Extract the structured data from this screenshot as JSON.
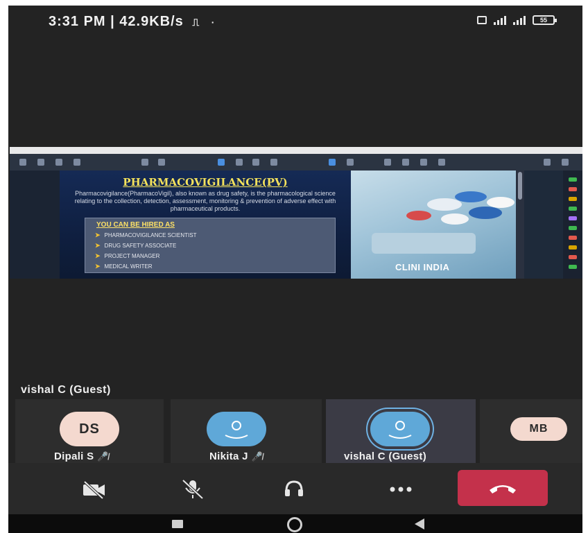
{
  "status_bar": {
    "time_speed": "3:31 PM | 42.9KB/s",
    "battery": "55"
  },
  "shared_screen": {
    "slide": {
      "title": "PHARMACOVIGILANCE(PV)",
      "description": "Pharmacovigilance(PharmacoVigil), also known as drug safety, is the pharmacological science relating to the collection, detection, assessment, monitoring & prevention of adverse effect with pharmaceutical products.",
      "box_heading": "YOU CAN BE HIRED AS",
      "bullets": [
        "PHARMACOVIGILANCE SCIENTIST",
        "DRUG SAFETY ASSOCIATE",
        "PROJECT MANAGER",
        "MEDICAL WRITER"
      ],
      "logo_text": "CLINI INDIA"
    }
  },
  "presenter_label": "vishal C (Guest)",
  "participants": [
    {
      "initials": "DS",
      "name": "Dipali S",
      "muted": "✕"
    },
    {
      "initials": "",
      "name": "Nikita J",
      "muted": "✕"
    },
    {
      "initials": "",
      "name": "vishal C (Guest)",
      "muted": ""
    },
    {
      "initials": "MB",
      "name": "",
      "muted": ""
    }
  ],
  "colors": {
    "end_call": "#c4314b",
    "avatar_blue": "#5fa8d8",
    "avatar_peach": "#f4d9cf",
    "slide_title": "#f4e25c",
    "background": "#232323"
  },
  "icons": {
    "camera": "camera-off-icon",
    "mic": "mic-off-icon",
    "audio": "headset-icon",
    "more": "more-dots-icon",
    "end_call": "hang-up-icon"
  }
}
